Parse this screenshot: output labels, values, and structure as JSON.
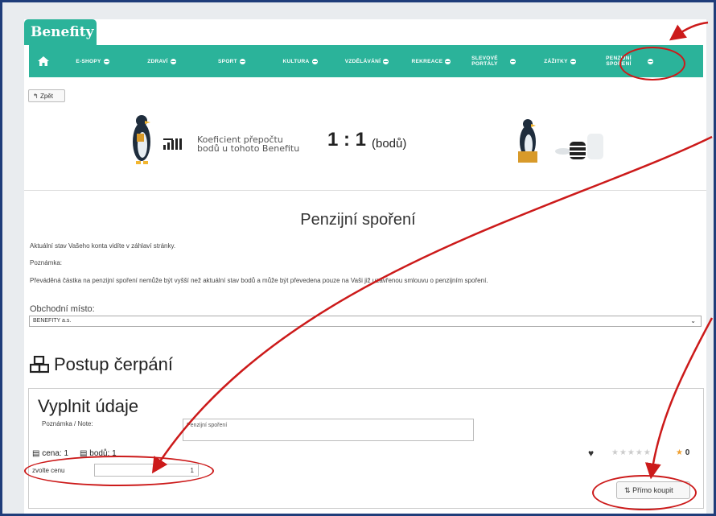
{
  "brand": {
    "logo_text": "Benefity",
    "accent": "#2bb39a",
    "annotation_color": "#cc1a1a"
  },
  "nav": {
    "home_icon": "home-icon",
    "items": [
      {
        "label": "E-SHOPY"
      },
      {
        "label": "ZDRAVÍ"
      },
      {
        "label": "SPORT"
      },
      {
        "label": "KULTURA"
      },
      {
        "label": "VZDĚLÁVÁNÍ"
      },
      {
        "label": "REKREACE"
      },
      {
        "label": "SLEVOVÉ PORTÁLY"
      },
      {
        "label": "ZÁŽITKY"
      },
      {
        "label": "PENZIJNÍ SPOŘENÍ"
      }
    ]
  },
  "back_button": "Zpět",
  "hero": {
    "coef_line1": "Koeficient přepočtu",
    "coef_line2": "bodů u tohoto Benefitu",
    "ratio": "1 : 1",
    "unit": "(bodů)"
  },
  "main": {
    "title": "Penzijní spoření",
    "info": "Aktuální stav Vašeho konta vidíte v záhlaví stránky.",
    "note_heading": "Poznámka:",
    "note_text": "Převáděná částka na penzijní spoření nemůže být vyšší než aktuální stav bodů a může být převedena pouze na Vaši již uzavřenou smlouvu o penzijním spoření.",
    "select_label": "Obchodní místo:",
    "select_value": "BENEFITY a.s."
  },
  "process": {
    "heading": "Postup čerpání",
    "card_title": "Vyplnit údaje",
    "note_label": "Poznámka / Note:",
    "note_value": "Penzijní spoření",
    "price_label": "cena: 1",
    "points_label": "bodů: 1",
    "choose_label": "zvolte cenu",
    "quantity": "1",
    "star_count": "0",
    "buy_label": "Přímo koupit"
  }
}
